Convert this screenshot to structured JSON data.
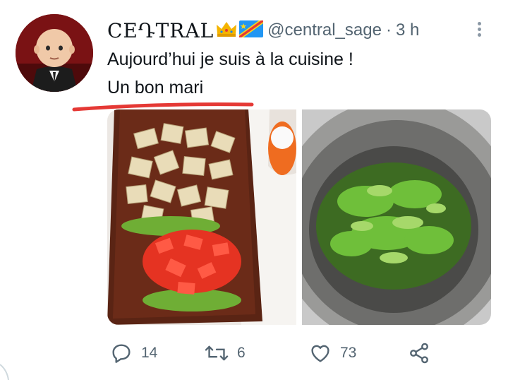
{
  "tweet": {
    "display_name": "CEԴTRAL",
    "name_emojis": [
      "crown-icon",
      "drc-flag-icon"
    ],
    "handle": "@central_sage",
    "separator": "·",
    "time": "3 h",
    "text_lines": [
      "Aujourd’hui je suis à la cuisine !",
      "Un bon mari"
    ],
    "underline_color": "#e53935"
  },
  "media": [
    {
      "description_icon": "chopping-board-photo",
      "accent": "#d23a2a"
    },
    {
      "description_icon": "cooked-greens-pot-photo",
      "accent": "#4f8f2a"
    }
  ],
  "actions": {
    "reply_count": "14",
    "retweet_count": "6",
    "like_count": "73",
    "share_icon": "share-icon"
  },
  "colors": {
    "text": "#0f1419",
    "muted": "#536471",
    "avatar_bg": "#7a1214"
  }
}
